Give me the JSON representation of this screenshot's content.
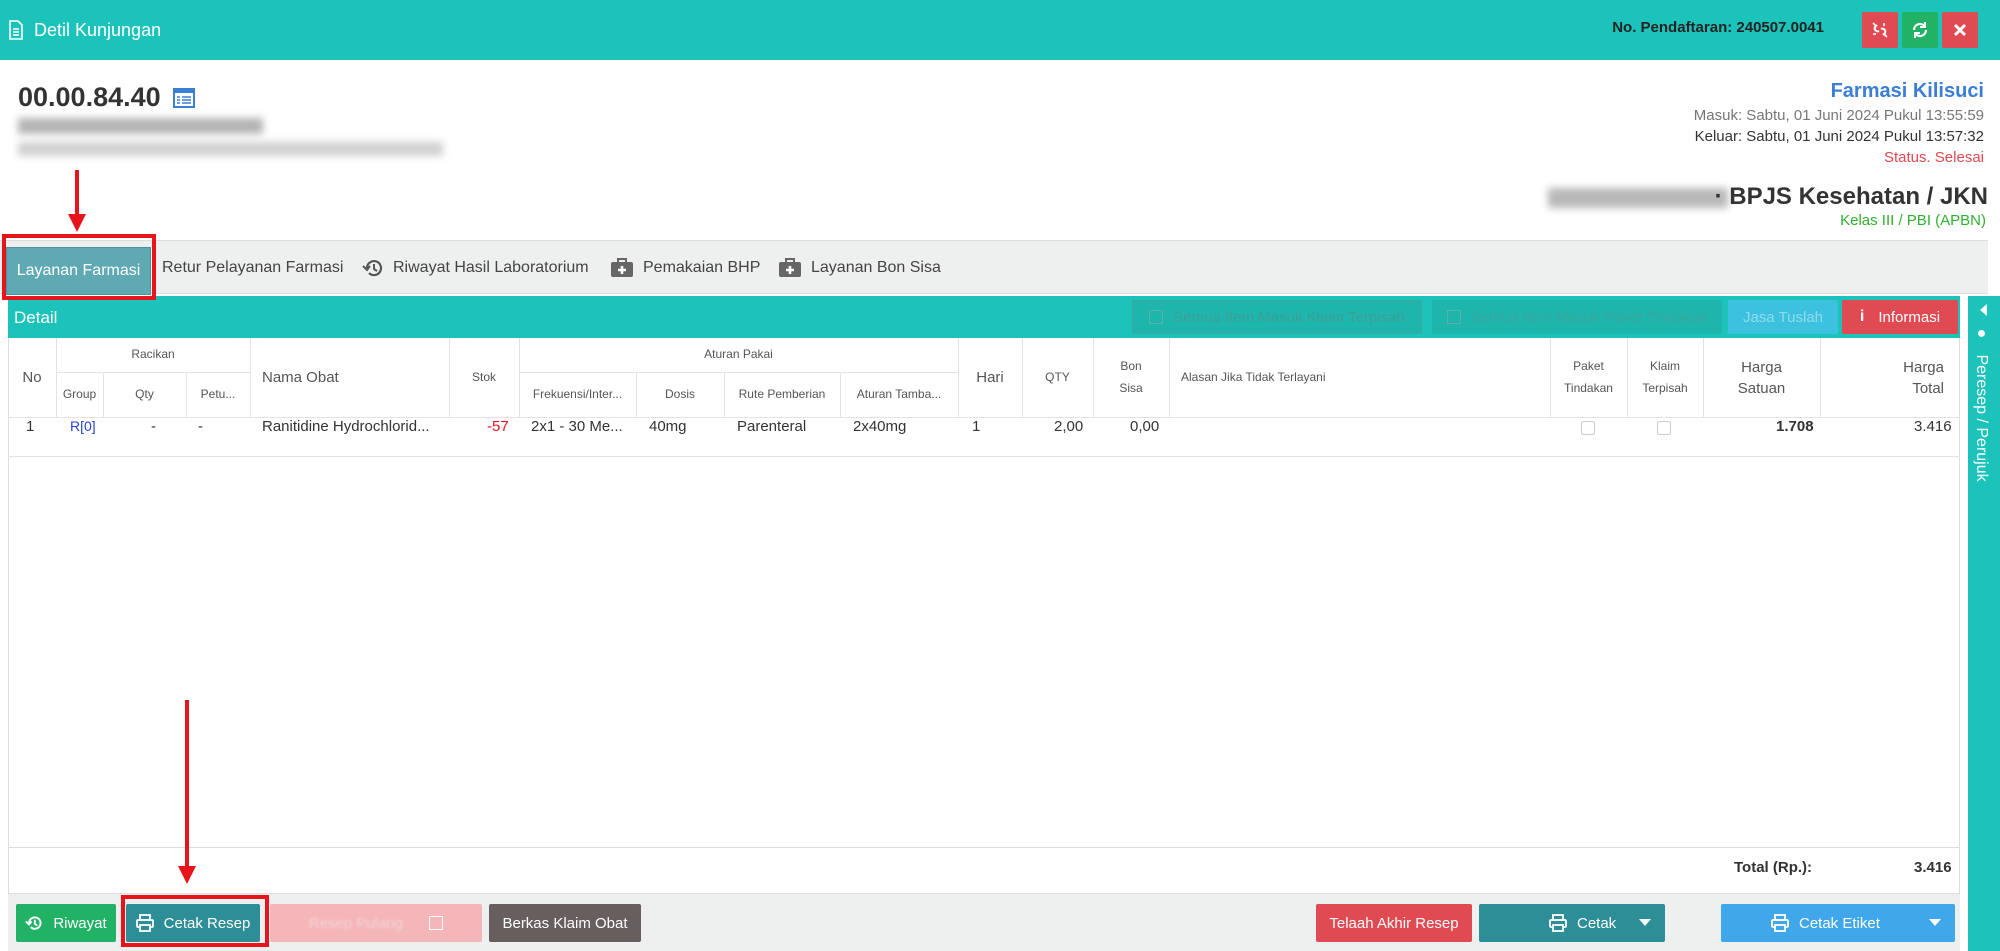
{
  "window": {
    "title": "Detil Kunjungan",
    "registration": "No. Pendaftaran: 240507.0041"
  },
  "patient": {
    "id": "00.00.84.40"
  },
  "visit": {
    "unit": "Farmasi Kilisuci",
    "masuk": "Masuk: Sabtu, 01 Juni 2024 Pukul 13:55:59",
    "keluar": "Keluar: Sabtu, 01 Juni 2024 Pukul 13:57:32",
    "status": "Status. Selesai",
    "insurance": "· BPJS Kesehatan / JKN",
    "kelas": "Kelas III / PBI (APBN)"
  },
  "tabs": [
    {
      "label": "Layanan Farmasi",
      "icon": "none"
    },
    {
      "label": "Retur Pelayanan Farmasi",
      "icon": "none"
    },
    {
      "label": "Riwayat Hasil Laboratorium",
      "icon": "history-icon"
    },
    {
      "label": "Pemakaian BHP",
      "icon": "medkit-icon"
    },
    {
      "label": "Layanan Bon Sisa",
      "icon": "medkit-icon"
    }
  ],
  "detail": {
    "title": "Detail",
    "klaim_label": "Semua Item Masuk Klaim Terpisah",
    "paket_label": "Semua Item Masuk Paket Tindakan",
    "jasa_label": "Jasa Tuslah",
    "info_label": "Informasi"
  },
  "table": {
    "headers": {
      "no": "No",
      "racikan": "Racikan",
      "group": "Group",
      "qty_racikan": "Qty",
      "petunjuk": "Petu...",
      "nama_obat": "Nama Obat",
      "stok": "Stok",
      "aturan_pakai": "Aturan Pakai",
      "frekuensi": "Frekuensi/Inter...",
      "dosis": "Dosis",
      "rute": "Rute Pemberian",
      "aturan_tambahan": "Aturan Tamba...",
      "hari": "Hari",
      "qty": "QTY",
      "bon_sisa_1": "Bon",
      "bon_sisa_2": "Sisa",
      "alasan": "Alasan Jika Tidak Terlayani",
      "paket_1": "Paket",
      "paket_2": "Tindakan",
      "klaim_1": "Klaim",
      "klaim_2": "Terpisah",
      "harga_satuan_1": "Harga",
      "harga_satuan_2": "Satuan",
      "harga_total_1": "Harga",
      "harga_total_2": "Total"
    },
    "rows": [
      {
        "no": "1",
        "group": "R[0]",
        "qty_racikan": "-",
        "petunjuk": "-",
        "nama_obat": "Ranitidine Hydrochlorid...",
        "stok": "-57",
        "frekuensi": "2x1 - 30 Me...",
        "dosis": "40mg",
        "rute": "Parenteral",
        "aturan_tambahan": "2x40mg",
        "hari": "1",
        "qty": "2,00",
        "bon_sisa": "0,00",
        "alasan": "",
        "paket_tindakan": false,
        "klaim_terpisah": false,
        "harga_satuan": "1.708",
        "harga_total": "3.416"
      }
    ],
    "total_label": "Total (Rp.):",
    "total_value": "3.416"
  },
  "footer": {
    "riwayat": "Riwayat",
    "cetak_resep": "Cetak Resep",
    "resep_pulang": "Resep Pulang",
    "berkas_klaim": "Berkas Klaim Obat",
    "telaah": "Telaah Akhir Resep",
    "cetak": "Cetak",
    "cetak_etiket": "Cetak Etiket"
  },
  "side_panel": {
    "label": "Peresep / Perujuk"
  },
  "colors": {
    "teal": "#1bc3ba",
    "red": "#e04a52",
    "green": "#21b266",
    "blue_link": "#3b7ed6",
    "annotation": "#e8141c"
  }
}
